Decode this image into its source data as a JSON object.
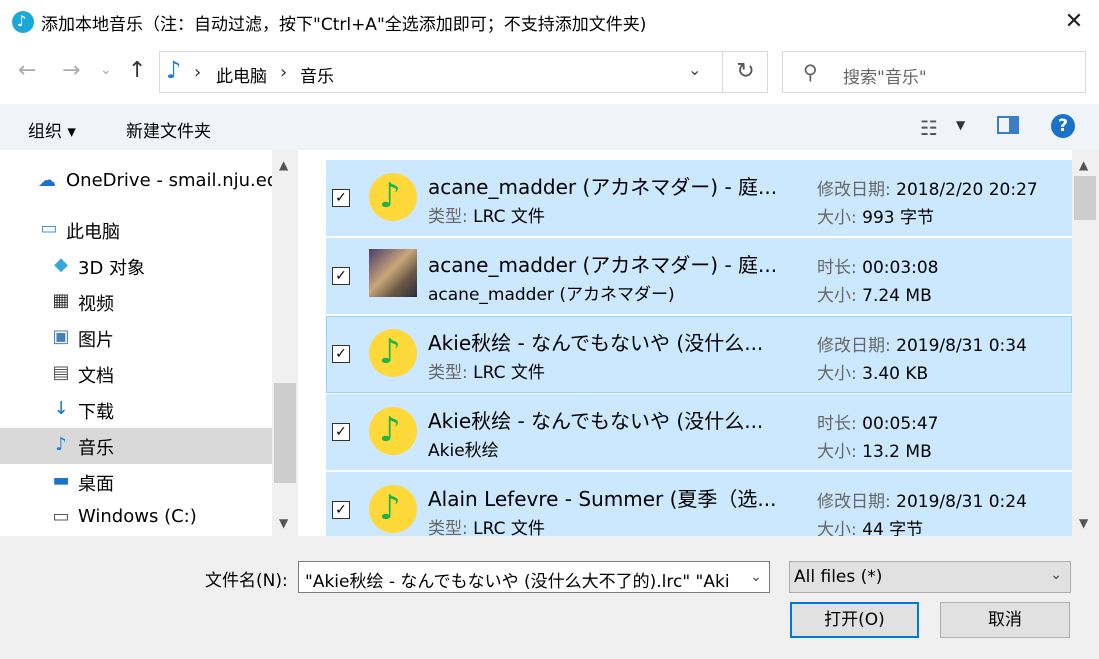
{
  "window": {
    "title": "添加本地音乐（注：自动过滤，按下\"Ctrl+A\"全选添加即可；不支持添加文件夹)",
    "close_label": "✕"
  },
  "nav": {
    "back": "←",
    "forward": "→",
    "history": "⌄",
    "up": "↑",
    "breadcrumb": [
      "此电脑",
      "音乐"
    ],
    "breadcrumb_sep": "›",
    "refresh": "↻",
    "search_placeholder": "搜索\"音乐\""
  },
  "toolbar": {
    "organize_label": "组织 ▾",
    "new_folder_label": "新建文件夹",
    "help_label": "?"
  },
  "sidebar": {
    "items": [
      {
        "label": "OneDrive - smail.nju.edu",
        "icon": "cloud-icon",
        "glyph": "☁",
        "color": "#1a73c9"
      },
      {
        "label": "此电脑",
        "icon": "computer-icon",
        "glyph": "🖳",
        "color": "#4a90d9"
      },
      {
        "label": "3D 对象",
        "icon": "cube-icon",
        "glyph": "◆",
        "color": "#3aa6d8"
      },
      {
        "label": "视频",
        "icon": "film-icon",
        "glyph": "▦",
        "color": "#333333"
      },
      {
        "label": "图片",
        "icon": "picture-icon",
        "glyph": "▣",
        "color": "#4a7fb5"
      },
      {
        "label": "文档",
        "icon": "document-icon",
        "glyph": "▤",
        "color": "#555555"
      },
      {
        "label": "下载",
        "icon": "download-icon",
        "glyph": "↓",
        "color": "#1a73c9"
      },
      {
        "label": "音乐",
        "icon": "music-icon",
        "glyph": "♪",
        "color": "#1a7fd6"
      },
      {
        "label": "桌面",
        "icon": "desktop-icon",
        "glyph": "▬",
        "color": "#1a73c9"
      },
      {
        "label": "Windows (C:)",
        "icon": "drive-icon",
        "glyph": "▭",
        "color": "#555555"
      }
    ]
  },
  "files": [
    {
      "name": "acane_madder (アカネマダー) - 庭...",
      "sub_label": "类型:",
      "sub_value": "LRC 文件",
      "meta1_label": "修改日期:",
      "meta1_value": "2018/2/20 20:27",
      "meta2_label": "大小:",
      "meta2_value": "993 字节",
      "icon": "qq-music-icon"
    },
    {
      "name": "acane_madder (アカネマダー) - 庭...",
      "sub_label": "",
      "sub_value": "acane_madder (アカネマダー)",
      "meta1_label": "时长:",
      "meta1_value": "00:03:08",
      "meta2_label": "大小:",
      "meta2_value": "7.24 MB",
      "icon": "album-art-icon"
    },
    {
      "name": "Akie秋绘 - なんでもないや (没什么...",
      "sub_label": "类型:",
      "sub_value": "LRC 文件",
      "meta1_label": "修改日期:",
      "meta1_value": "2019/8/31 0:34",
      "meta2_label": "大小:",
      "meta2_value": "3.40 KB",
      "icon": "qq-music-icon"
    },
    {
      "name": "Akie秋绘 - なんでもないや (没什么...",
      "sub_label": "",
      "sub_value": "Akie秋绘",
      "meta1_label": "时长:",
      "meta1_value": "00:05:47",
      "meta2_label": "大小:",
      "meta2_value": "13.2 MB",
      "icon": "qq-music-icon"
    },
    {
      "name": "Alain Lefevre - Summer (夏季（选...",
      "sub_label": "类型:",
      "sub_value": "LRC 文件",
      "meta1_label": "修改日期:",
      "meta1_value": "2019/8/31 0:24",
      "meta2_label": "大小:",
      "meta2_value": "44 字节",
      "icon": "qq-music-icon"
    }
  ],
  "bottom": {
    "filename_label": "文件名(N):",
    "filename_value": "\"Akie秋绘 - なんでもないや (没什么大不了的).lrc\" \"Aki",
    "filetype_value": "All files  (*)",
    "open_label": "打开(O)",
    "cancel_label": "取消"
  },
  "colors": {
    "selection": "#cce8ff",
    "accent": "#0078d7"
  }
}
